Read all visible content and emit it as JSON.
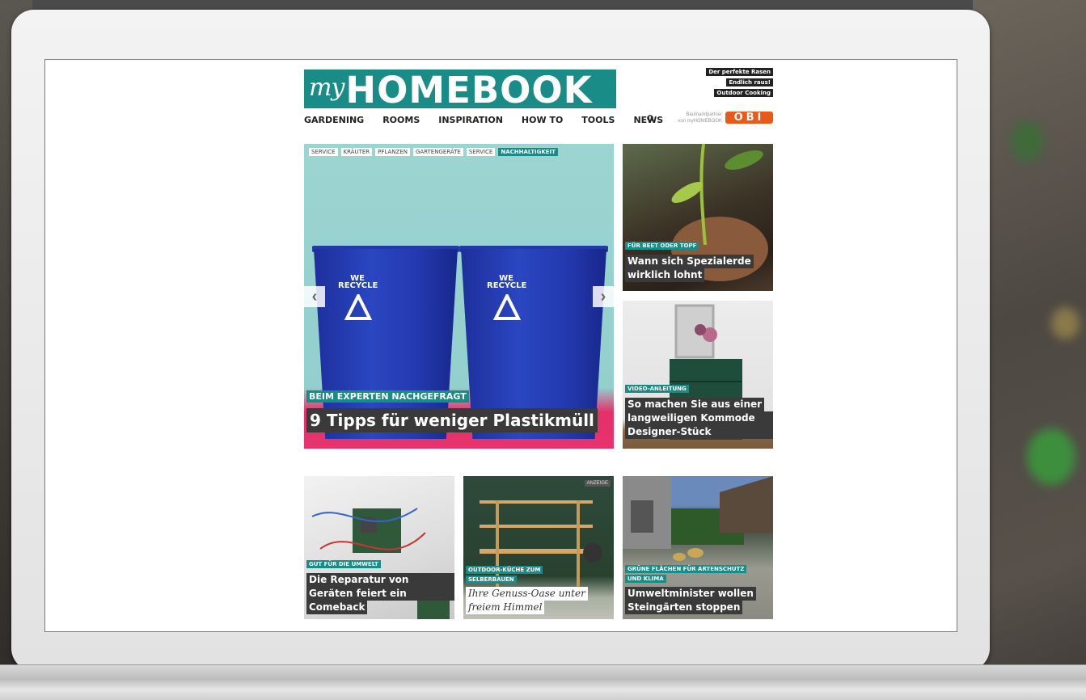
{
  "logo": {
    "my": "my",
    "homebook": "HOMEBOOK"
  },
  "top_links": [
    "Der perfekte Rasen",
    "Endlich raus!",
    "Outdoor Cooking"
  ],
  "nav": [
    "GARDENING",
    "ROOMS",
    "INSPIRATION",
    "HOW TO",
    "TOOLS",
    "NEWS"
  ],
  "partner": {
    "line1": "Baumarktpartner",
    "line2": "von myHOMEBOOK",
    "brand": "OBI"
  },
  "hero": {
    "tags": [
      "SERVICE",
      "KRÄUTER",
      "PFLANZEN",
      "GARTENGERÄTE",
      "SERVICE",
      "NACHHALTIGKEIT"
    ],
    "active_tag": "NACHHALTIGKEIT",
    "kicker": "BEIM EXPERTEN NACHGEFRAGT",
    "title": "9 Tipps für weniger Plastikmüll",
    "bin_text": "WE RECYCLE"
  },
  "side_cards": [
    {
      "kicker": "FÜR BEET ODER TOPF",
      "title_lines": [
        "Wann sich Spezialerde",
        "wirklich lohnt"
      ]
    },
    {
      "kicker": "VIDEO-ANLEITUNG",
      "title_lines": [
        "So machen Sie aus einer",
        "langweiligen Kommode ein",
        "Designer-Stück"
      ]
    }
  ],
  "bottom_cards": [
    {
      "kicker": "GUT FÜR DIE UMWELT",
      "title_lines": [
        "Die Reparatur von defekten",
        "Geräten feiert ein",
        "Comeback"
      ]
    },
    {
      "kicker_lines": [
        "OUTDOOR-KÜCHE ZUM",
        "SELBERBAUEN"
      ],
      "title_lines": [
        "Ihre Genuss-Oase unter",
        "freiem Himmel"
      ],
      "ad": "ANZEIGE"
    },
    {
      "kicker_lines": [
        "GRÜNE FLÄCHEN FÜR ARTENSCHUTZ",
        "UND KLIMA"
      ],
      "title_lines": [
        "Umweltminister wollen",
        "Steingärten stoppen"
      ]
    }
  ],
  "colors": {
    "brand": "#1a8c87",
    "obi": "#e85a1a",
    "headline_bg": "#3a3a3a"
  }
}
